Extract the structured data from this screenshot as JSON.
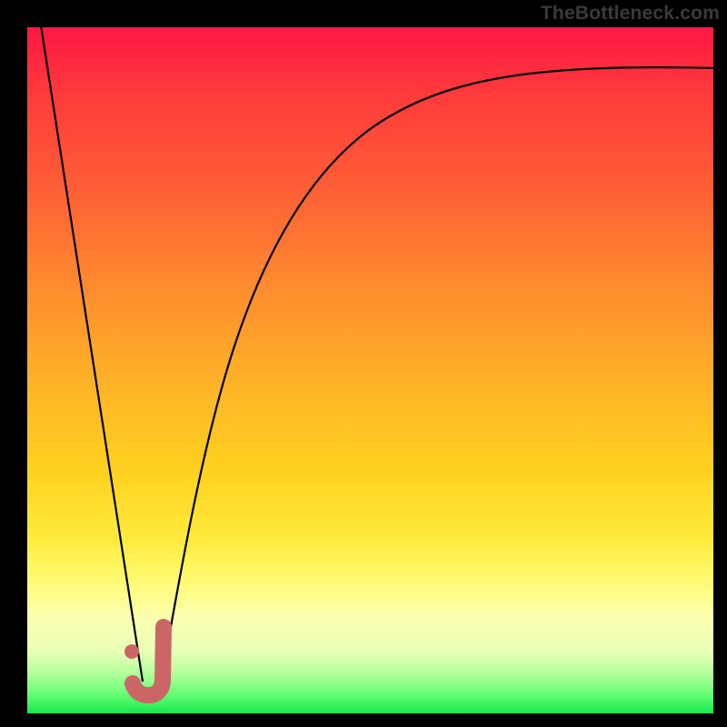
{
  "watermark": "TheBottleneck.com",
  "colors": {
    "gradient_top": "#ff1744",
    "gradient_mid": "#ffd21f",
    "gradient_bottom": "#17e84d",
    "curve": "#000000",
    "marker": "#cc6666",
    "frame": "#000000"
  },
  "chart_data": {
    "type": "line",
    "title": "",
    "xlabel": "",
    "ylabel": "",
    "xlim": [
      0,
      100
    ],
    "ylim": [
      0,
      100
    ],
    "grid": false,
    "legend": false,
    "series": [
      {
        "name": "left-falling-line",
        "x": [
          2,
          17
        ],
        "y": [
          100,
          5
        ]
      },
      {
        "name": "right-rising-curve",
        "x": [
          19,
          22,
          26,
          30,
          35,
          40,
          46,
          52,
          60,
          70,
          82,
          94,
          100
        ],
        "y": [
          3,
          18,
          36,
          50,
          62,
          71,
          78,
          83,
          87,
          90,
          92,
          93.5,
          94
        ]
      }
    ],
    "marker": {
      "name": "J-marker",
      "dot": {
        "x": 15.3,
        "y": 9
      },
      "stroke_points": [
        {
          "x": 15.3,
          "y": 4.5
        },
        {
          "x": 16.5,
          "y": 2.8
        },
        {
          "x": 18.2,
          "y": 2.8
        },
        {
          "x": 19.6,
          "y": 4.2
        },
        {
          "x": 19.8,
          "y": 12.5
        }
      ]
    }
  }
}
